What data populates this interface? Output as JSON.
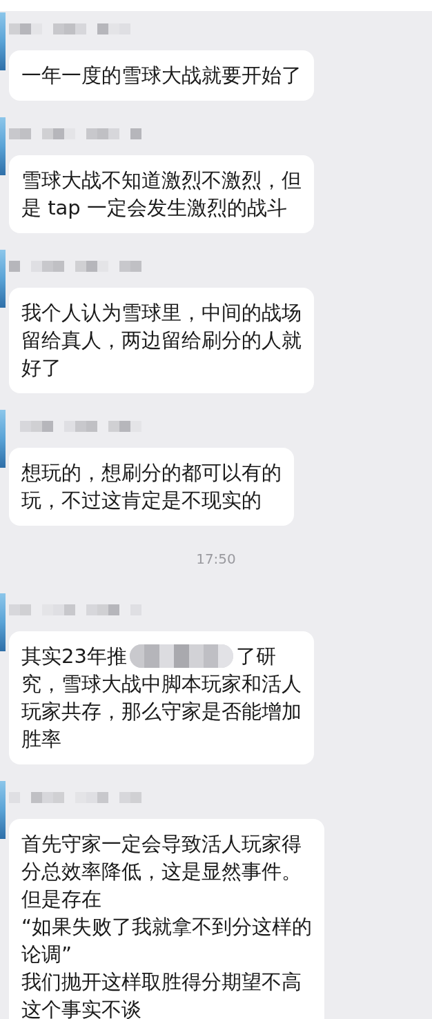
{
  "messages": [
    {
      "lines": [
        "一年一度的雪球大战就要开始了"
      ]
    },
    {
      "lines": [
        "雪球大战不知道激烈不激烈，但",
        "是 tap 一定会发生激烈的战斗"
      ]
    },
    {
      "lines": [
        "我个人认为雪球里，中间的战场",
        "留给真人，两边留给刷分的人就",
        "好了"
      ]
    },
    {
      "lines": [
        "想玩的，想刷分的都可以有的",
        "玩，不过这肯定是不现实的"
      ]
    },
    {
      "time": "17:50"
    },
    {
      "lines": [
        {
          "kind": "redacted",
          "before": "其实23年推",
          "after": "了研"
        },
        "究，雪球大战中脚本玩家和活人",
        "玩家共存，那么守家是否能增加",
        "胜率"
      ]
    },
    {
      "lines": [
        "首先守家一定会导致活人玩家得",
        "分总效率降低，这是显然事件。",
        "但是存在",
        "“如果失败了我就拿不到分这样的",
        "论调”",
        "我们抛开这样取胜得分期望不高",
        "这个事实不谈"
      ]
    }
  ]
}
